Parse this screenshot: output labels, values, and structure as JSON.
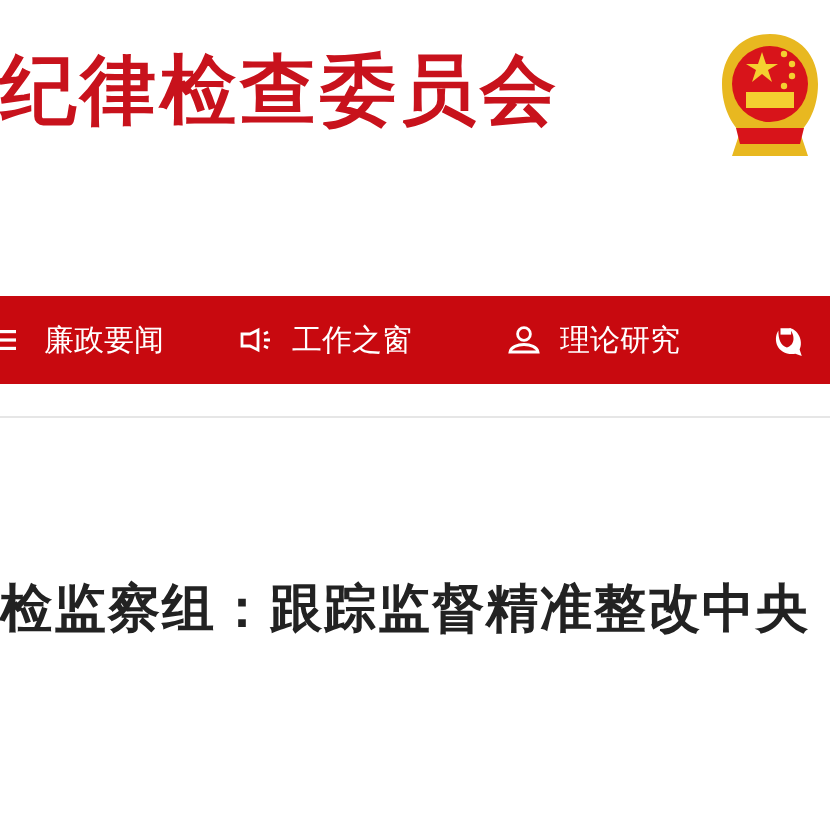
{
  "header": {
    "title": "纪律检查委员会"
  },
  "nav": {
    "items": [
      {
        "kind": "list",
        "label": "廉政要闻"
      },
      {
        "kind": "speaker",
        "label": "工作之窗"
      },
      {
        "kind": "person",
        "label": "理论研究"
      },
      {
        "kind": "party"
      }
    ]
  },
  "article": {
    "headline": "检监察组：跟踪监督精准整改中央"
  }
}
